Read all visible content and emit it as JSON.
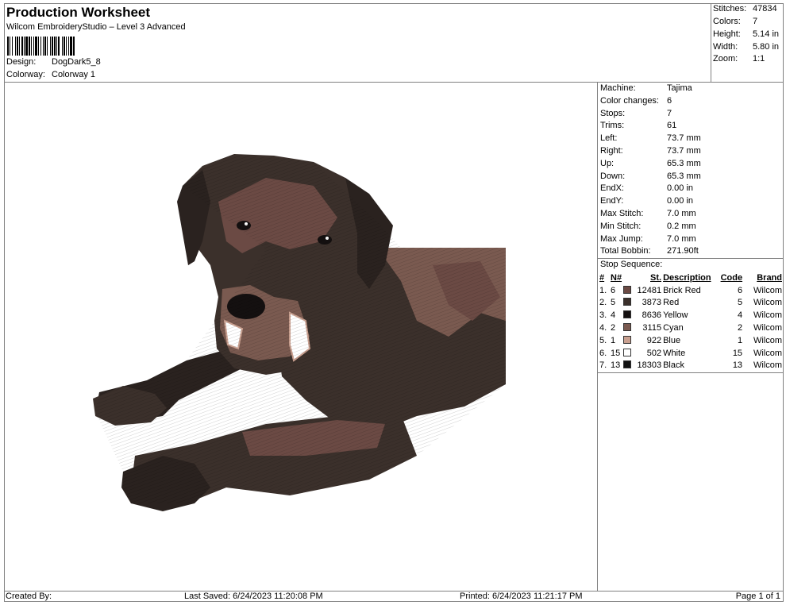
{
  "header": {
    "title": "Production Worksheet",
    "subtitle": "Wilcom EmbroideryStudio – Level 3 Advanced",
    "design_label": "Design:",
    "design_value": "DogDark5_8",
    "colorway_label": "Colorway:",
    "colorway_value": "Colorway 1"
  },
  "stats": [
    {
      "label": "Stitches:",
      "value": "47834"
    },
    {
      "label": "Colors:",
      "value": "7"
    },
    {
      "label": "Height:",
      "value": "5.14 in"
    },
    {
      "label": "Width:",
      "value": "5.80 in"
    },
    {
      "label": "Zoom:",
      "value": "1:1"
    }
  ],
  "machine_info": [
    {
      "label": "Machine:",
      "value": "Tajima"
    },
    {
      "label": "Color changes:",
      "value": "6"
    },
    {
      "label": "Stops:",
      "value": "7"
    },
    {
      "label": "Trims:",
      "value": "61"
    },
    {
      "label": "Left:",
      "value": "73.7 mm"
    },
    {
      "label": "Right:",
      "value": "73.7 mm"
    },
    {
      "label": "Up:",
      "value": "65.3 mm"
    },
    {
      "label": "Down:",
      "value": "65.3 mm"
    },
    {
      "label": "EndX:",
      "value": "0.00 in"
    },
    {
      "label": "EndY:",
      "value": "0.00 in"
    },
    {
      "label": "Max Stitch:",
      "value": "7.0 mm"
    },
    {
      "label": "Min Stitch:",
      "value": "0.2 mm"
    },
    {
      "label": "Max Jump:",
      "value": "7.0 mm"
    },
    {
      "label": "Total Bobbin:",
      "value": "271.90ft"
    }
  ],
  "stop_sequence": {
    "title": "Stop Sequence:",
    "headers": {
      "num": "#",
      "needle": "N#",
      "stitches": "St.",
      "description": "Description",
      "code": "Code",
      "brand": "Brand"
    },
    "rows": [
      {
        "num": "1.",
        "needle": "6",
        "color": "#6b4a44",
        "stitches": "12481",
        "description": "Brick Red",
        "code": "6",
        "brand": "Wilcom"
      },
      {
        "num": "2.",
        "needle": "5",
        "color": "#3b302b",
        "stitches": "3873",
        "description": "Red",
        "code": "5",
        "brand": "Wilcom"
      },
      {
        "num": "3.",
        "needle": "4",
        "color": "#141010",
        "stitches": "8636",
        "description": "Yellow",
        "code": "4",
        "brand": "Wilcom"
      },
      {
        "num": "4.",
        "needle": "2",
        "color": "#7a5a50",
        "stitches": "3115",
        "description": "Cyan",
        "code": "2",
        "brand": "Wilcom"
      },
      {
        "num": "5.",
        "needle": "1",
        "color": "#c9a090",
        "stitches": "922",
        "description": "Blue",
        "code": "1",
        "brand": "Wilcom"
      },
      {
        "num": "6.",
        "needle": "15",
        "color": "#ffffff",
        "stitches": "502",
        "description": "White",
        "code": "15",
        "brand": "Wilcom"
      },
      {
        "num": "7.",
        "needle": "13",
        "color": "#111111",
        "stitches": "18303",
        "description": "Black",
        "code": "13",
        "brand": "Wilcom"
      }
    ]
  },
  "footer": {
    "created_by": "Created By:",
    "last_saved": "Last Saved: 6/24/2023 11:20:08 PM",
    "printed": "Printed: 6/24/2023 11:21:17 PM",
    "page": "Page 1 of 1"
  },
  "design_colors": {
    "body": "#3b302b",
    "highlight": "#6b4a44",
    "mid": "#7a5a50",
    "dark": "#141010",
    "muzzle": "#c9a090",
    "white": "#ffffff"
  }
}
